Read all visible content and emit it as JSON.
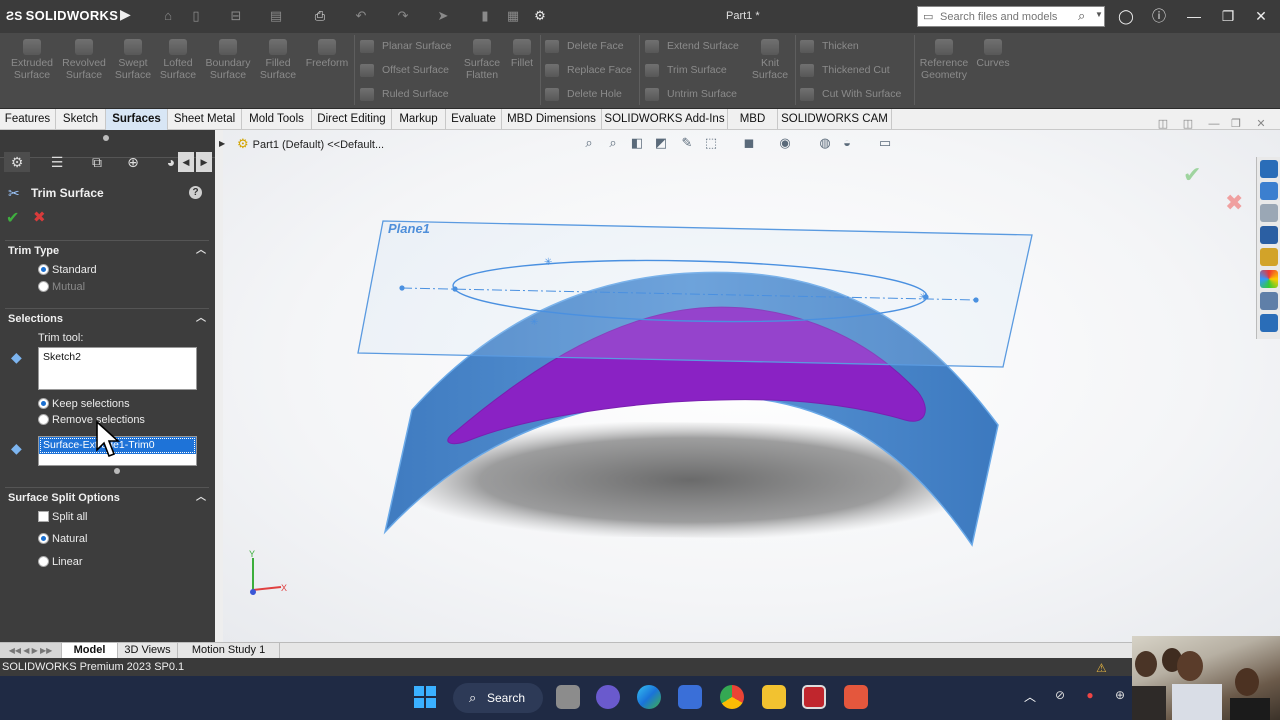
{
  "app": {
    "logo": "SOLIDWORKS",
    "document_title": "Part1 *"
  },
  "search": {
    "placeholder": "Search files and models"
  },
  "ribbon": {
    "large_buttons": [
      {
        "label": "Extruded\nSurface"
      },
      {
        "label": "Revolved\nSurface"
      },
      {
        "label": "Swept\nSurface"
      },
      {
        "label": "Lofted\nSurface"
      },
      {
        "label": "Boundary\nSurface"
      },
      {
        "label": "Filled\nSurface"
      },
      {
        "label": "Freeform"
      }
    ],
    "group1_small": [
      "Planar Surface",
      "Offset Surface",
      "Ruled Surface"
    ],
    "mid_large": [
      {
        "label": "Surface\nFlatten"
      },
      {
        "label": "Fillet"
      }
    ],
    "group2_small": [
      "Delete Face",
      "Replace Face",
      "Delete Hole"
    ],
    "group3_small": [
      "Extend Surface",
      "Trim Surface",
      "Untrim Surface"
    ],
    "knit": {
      "label": "Knit\nSurface"
    },
    "group4_small": [
      "Thicken",
      "Thickened Cut",
      "Cut With Surface"
    ],
    "ref_geometry": {
      "label": "Reference\nGeometry"
    },
    "curves": {
      "label": "Curves"
    }
  },
  "tabs": [
    "Features",
    "Sketch",
    "Surfaces",
    "Sheet Metal",
    "Mold Tools",
    "Direct Editing",
    "Markup",
    "Evaluate",
    "MBD Dimensions",
    "SOLIDWORKS Add-Ins",
    "MBD",
    "SOLIDWORKS CAM"
  ],
  "active_tab": "Surfaces",
  "property_manager": {
    "title": "Trim Surface",
    "trim_type": {
      "header": "Trim Type",
      "standard": "Standard",
      "mutual": "Mutual",
      "selected": "Standard"
    },
    "selections": {
      "header": "Selections",
      "trim_tool_label": "Trim tool:",
      "trim_tool_value": "Sketch2",
      "keep": "Keep selections",
      "remove": "Remove selections",
      "selected": "Keep selections",
      "pieces_value": "Surface-Extrude1-Trim0"
    },
    "split_options": {
      "header": "Surface Split Options",
      "split_all": "Split all",
      "split_all_checked": false,
      "natural": "Natural",
      "linear": "Linear",
      "selected": "Natural"
    }
  },
  "viewport": {
    "tree_item": "Part1  (Default) <<Default...",
    "plane_label": "Plane1",
    "triad_y": "Y",
    "triad_x": "X"
  },
  "bottom_tabs": [
    "Model",
    "3D Views",
    "Motion Study 1"
  ],
  "active_bottom_tab": "Model",
  "status": "SOLIDWORKS Premium 2023 SP0.1",
  "taskbar": {
    "search_label": "Search"
  },
  "colors": {
    "ribbon_bg": "#4a4a4a",
    "panel_bg": "#3d3d3d",
    "surface_blue": "#4a86c8",
    "trim_purple": "#8a22c4",
    "selection_blue": "#1e73d8",
    "taskbar_bg": "#1f2a44"
  }
}
